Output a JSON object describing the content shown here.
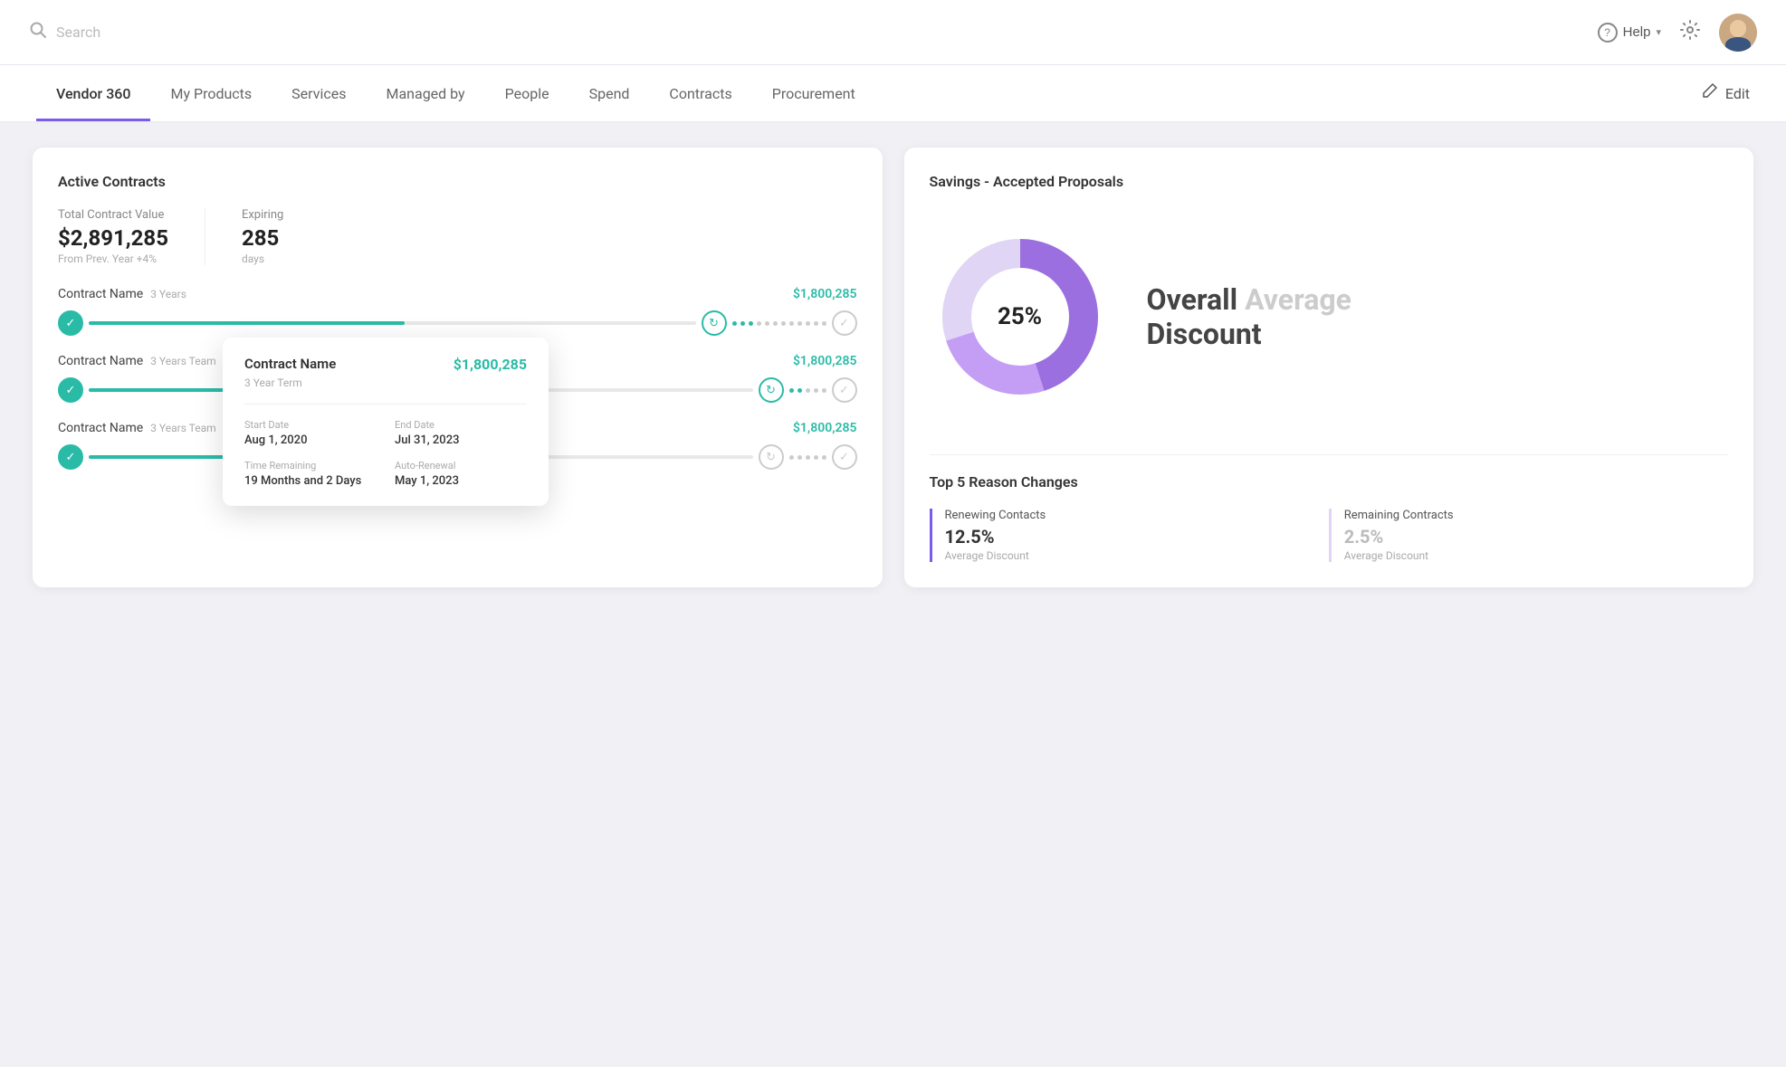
{
  "header": {
    "search_placeholder": "Search",
    "help_label": "Help",
    "edit_label": "Edit"
  },
  "nav": {
    "tabs": [
      {
        "id": "vendor360",
        "label": "Vendor 360",
        "active": true
      },
      {
        "id": "myproducts",
        "label": "My Products",
        "active": false
      },
      {
        "id": "services",
        "label": "Services",
        "active": false
      },
      {
        "id": "managedby",
        "label": "Managed by",
        "active": false
      },
      {
        "id": "people",
        "label": "People",
        "active": false
      },
      {
        "id": "spend",
        "label": "Spend",
        "active": false
      },
      {
        "id": "contracts",
        "label": "Contracts",
        "active": false
      },
      {
        "id": "procurement",
        "label": "Procurement",
        "active": false
      }
    ]
  },
  "active_contracts": {
    "card_title": "Active Contracts",
    "total_label": "Total Contract Value",
    "total_value": "$2,891,285",
    "total_sub": "From Prev. Year +4%",
    "expiring_label": "Expiring",
    "expiring_value": "285",
    "expiring_sub": "days",
    "contracts": [
      {
        "name": "Contract Name",
        "term": "3 Years",
        "team": "",
        "amount": "$1,800,285",
        "fill_pct": 52,
        "dots": [
          false,
          false,
          false,
          false,
          false,
          false,
          false,
          false,
          false,
          false,
          false,
          false
        ],
        "active_dots": 3
      },
      {
        "name": "Contract Name",
        "term": "3 Years Team",
        "team": "",
        "amount": "$1,800,285",
        "fill_pct": 65,
        "dots": [
          false,
          false,
          false,
          false,
          false
        ],
        "active_dots": 2
      },
      {
        "name": "Contract Name",
        "term": "3 Years Team",
        "team": "",
        "amount": "$1,800,285",
        "fill_pct": 30,
        "dots": [
          false,
          false,
          false,
          false,
          false
        ],
        "active_dots": 0
      }
    ],
    "tooltip": {
      "name": "Contract Name",
      "term": "3 Year Term",
      "amount": "$1,800,285",
      "start_label": "Start Date",
      "start_value": "Aug 1, 2020",
      "end_label": "End Date",
      "end_value": "Jul 31, 2023",
      "remaining_label": "Time Remaining",
      "remaining_value": "19 Months and 2 Days",
      "autorenewal_label": "Auto-Renewal",
      "autorenewal_value": "May 1, 2023"
    }
  },
  "savings": {
    "card_title": "Savings - Accepted Proposals",
    "donut_percent": "25%",
    "overall_label_1": "Overall",
    "overall_label_2": "Average",
    "overall_label_3": "Discount",
    "top5_title": "Top 5 Reason Changes",
    "reasons": [
      {
        "title": "Renewing Contacts",
        "percent": "12.5%",
        "sub": "Average Discount",
        "accent": true
      },
      {
        "title": "Remaining Contracts",
        "percent": "2.5%",
        "sub": "Average Discount",
        "accent": false
      }
    ],
    "donut_segments": [
      {
        "color": "#9b6fdf",
        "pct": 45
      },
      {
        "color": "#c49ef5",
        "pct": 25
      },
      {
        "color": "#e8d5ff",
        "pct": 30
      }
    ]
  }
}
